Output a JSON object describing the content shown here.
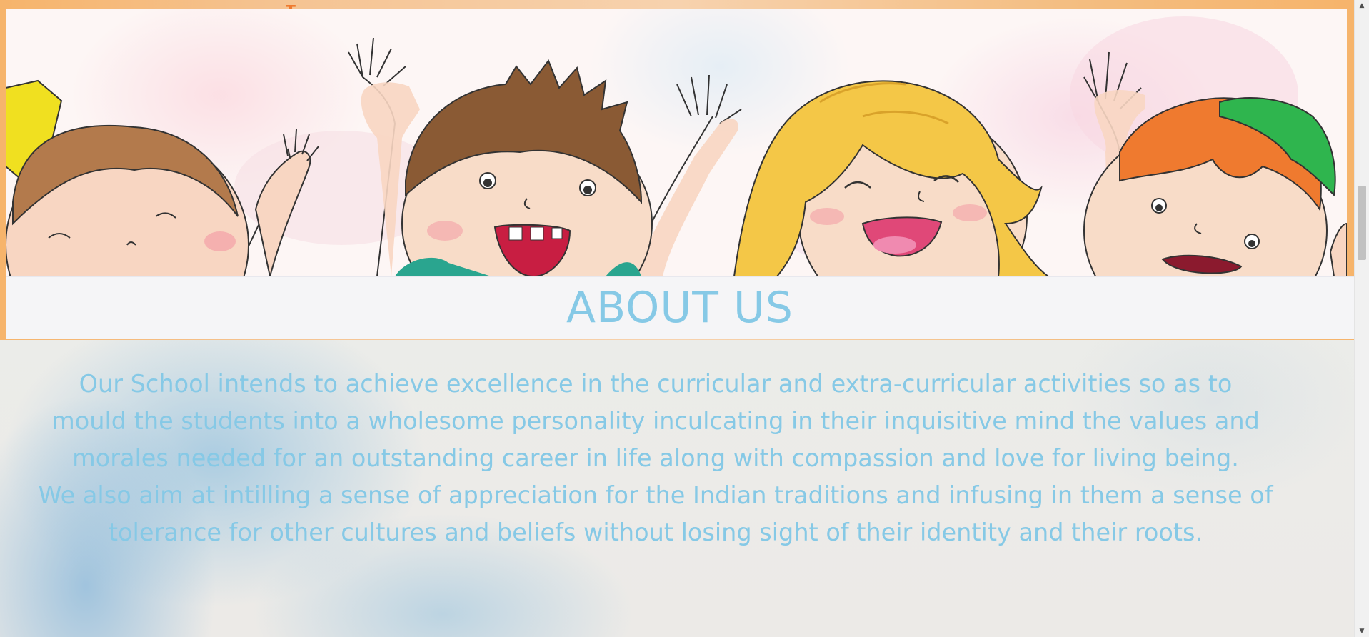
{
  "hero": {
    "alt": "Cartoon children cheering with raised hands"
  },
  "about": {
    "title": "ABOUT US",
    "paragraph_lines": [
      "Our School intends to achieve excellence in the curricular and extra-curricular activities so as to",
      "mould the students into a wholesome personality inculcating in their inquisitive mind the values and",
      "morales needed for an outstanding career in life along with compassion and love for living being.",
      "We also aim at intilling a sense of appreciation for the Indian traditions and infusing in them a sense of",
      "tolerance for other cultures and beliefs without losing sight of their identity and their roots."
    ]
  },
  "scrollbar": {
    "up_icon": "scroll-up-arrow",
    "down_icon": "scroll-down-arrow",
    "position_fraction": 0.29
  },
  "colors": {
    "accent_text": "#86c9e6",
    "banner_orange": "#f6b46b",
    "band_background": "#f5f5f7"
  }
}
